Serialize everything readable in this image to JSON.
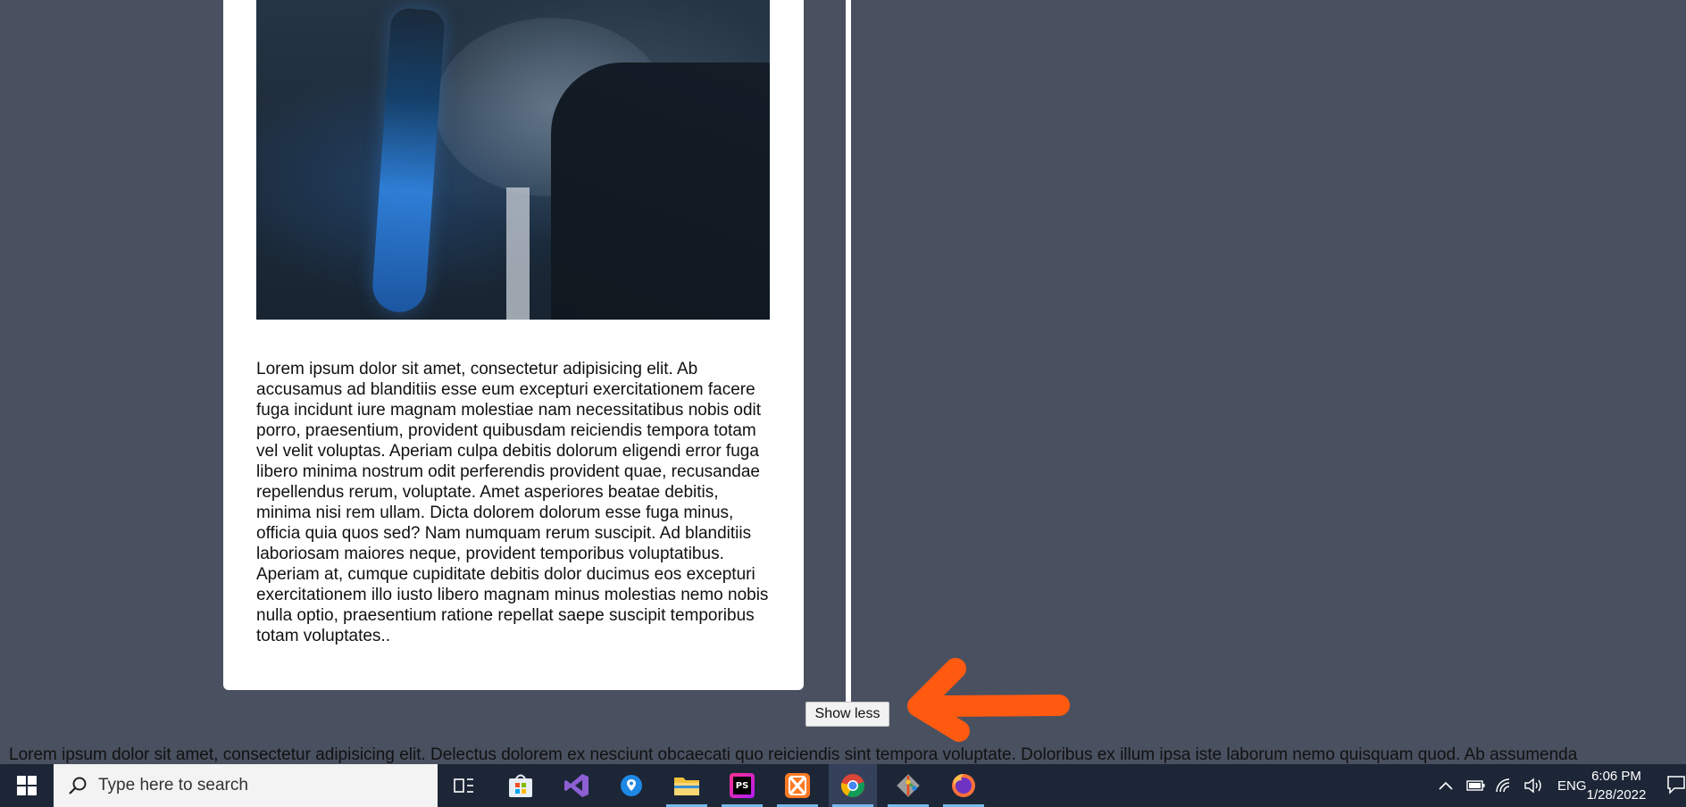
{
  "card": {
    "paragraph": "Lorem ipsum dolor sit amet, consectetur adipisicing elit. Ab accusamus ad blanditiis esse eum excepturi exercitationem facere fuga incidunt iure magnam molestiae nam necessitatibus nobis odit porro, praesentium, provident quibusdam reiciendis tempora totam vel velit voluptas. Aperiam culpa debitis dolorum eligendi error fuga libero minima nostrum odit perferendis provident quae, recusandae repellendus rerum, voluptate. Amet asperiores beatae debitis, minima nisi rem ullam. Dicta dolorem dolorum esse fuga minus, officia quia quos sed? Nam numquam rerum suscipit. Ad blanditiis laboriosam maiores neque, provident temporibus voluptatibus. Aperiam at, cumque cupiditate debitis dolor ducimus eos excepturi exercitationem illo iusto libero magnam minus molestias nemo nobis nulla optio, praesentium ratione repellat saepe suscipit temporibus totam voluptates.."
  },
  "show_less_label": "Show less",
  "bottom_text": "Lorem ipsum dolor sit amet, consectetur adipisicing elit. Delectus dolorem ex nesciunt obcaecati quo reiciendis sint tempora voluptate. Doloribus ex illum ipsa iste laborum nemo quisquam quod. Ab assumenda",
  "colors": {
    "page_background": "#495060",
    "annotation_arrow": "#ff5a10",
    "taskbar": "#1c2637"
  },
  "taskbar": {
    "search_placeholder": "Type here to search",
    "apps": [
      {
        "icon": "task-view-icon"
      },
      {
        "icon": "microsoft-store-icon"
      },
      {
        "icon": "visual-studio-icon"
      },
      {
        "icon": "maps-icon"
      },
      {
        "icon": "file-explorer-icon"
      },
      {
        "icon": "phpstorm-icon",
        "text": "PS"
      },
      {
        "icon": "xampp-icon"
      },
      {
        "icon": "chrome-icon"
      },
      {
        "icon": "git-icon"
      },
      {
        "icon": "firefox-icon"
      }
    ],
    "tray": {
      "language": "ENG",
      "time": "6:06 PM",
      "date": "1/28/2022"
    }
  }
}
